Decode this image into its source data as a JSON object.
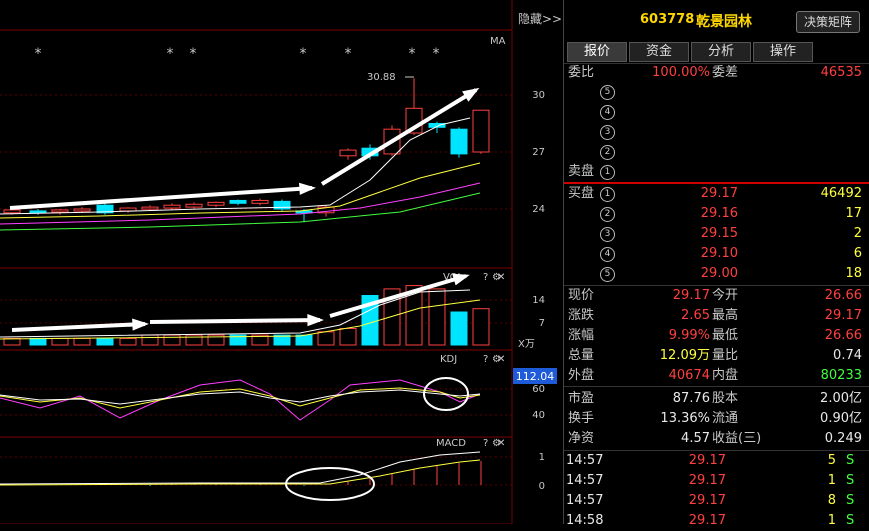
{
  "toolbar": {
    "hide_label": "隐藏>>"
  },
  "chart": {
    "main_indicator": "MA",
    "high_price_label": "30.88",
    "price_ticks": [
      "30",
      "27",
      "24"
    ],
    "vol_label": "VOL",
    "vol_ticks": [
      "14",
      "7"
    ],
    "vol_unit": "X万",
    "kdj_label": "KDJ",
    "kdj_value": "112.04",
    "kdj_ticks": [
      "60",
      "40"
    ],
    "macd_label": "MACD",
    "macd_ticks": [
      "1",
      "0"
    ],
    "star_marks": [
      "*",
      "*",
      "*",
      "*",
      "*",
      "*",
      "*"
    ]
  },
  "quote": {
    "code": "603778",
    "name": "乾景园林",
    "strategy_button": "决策矩阵",
    "tabs": [
      "报价",
      "资金",
      "分析",
      "操作"
    ],
    "weibi_label": "委比",
    "weibi_value": "100.00%",
    "weicha_label": "委差",
    "weicha_value": "46535",
    "sell_levels": [
      {
        "n": "5",
        "price": "",
        "vol": ""
      },
      {
        "n": "4",
        "price": "",
        "vol": ""
      },
      {
        "n": "3",
        "price": "",
        "vol": ""
      },
      {
        "n": "2",
        "price": "",
        "vol": ""
      },
      {
        "n": "1",
        "prefix": "卖盘",
        "price": "",
        "vol": ""
      }
    ],
    "buy_levels": [
      {
        "n": "1",
        "prefix": "买盘",
        "price": "29.17",
        "vol": "46492"
      },
      {
        "n": "2",
        "price": "29.16",
        "vol": "17"
      },
      {
        "n": "3",
        "price": "29.15",
        "vol": "2"
      },
      {
        "n": "4",
        "price": "29.10",
        "vol": "6"
      },
      {
        "n": "5",
        "price": "29.00",
        "vol": "18"
      }
    ],
    "stats": [
      {
        "l1": "现价",
        "v1": "29.17",
        "c1": "red",
        "l2": "今开",
        "v2": "26.66",
        "c2": "red"
      },
      {
        "l1": "涨跌",
        "v1": "2.65",
        "c1": "red",
        "l2": "最高",
        "v2": "29.17",
        "c2": "red"
      },
      {
        "l1": "涨幅",
        "v1": "9.99%",
        "c1": "red",
        "l2": "最低",
        "v2": "26.66",
        "c2": "red"
      },
      {
        "l1": "总量",
        "v1": "12.09万",
        "c1": "yellow",
        "l2": "量比",
        "v2": "0.74",
        "c2": "white"
      },
      {
        "l1": "外盘",
        "v1": "40674",
        "c1": "red",
        "l2": "内盘",
        "v2": "80233",
        "c2": "green"
      },
      {
        "l1": "市盈",
        "v1": "87.76",
        "c1": "white",
        "l2": "股本",
        "v2": "2.00亿",
        "c2": "white"
      },
      {
        "l1": "换手",
        "v1": "13.36%",
        "c1": "white",
        "l2": "流通",
        "v2": "0.90亿",
        "c2": "white"
      },
      {
        "l1": "净资",
        "v1": "4.57",
        "c1": "white",
        "l2": "收益(三)",
        "v2": "0.249",
        "c2": "white"
      }
    ],
    "ticks": [
      {
        "time": "14:57",
        "price": "29.17",
        "vol": "5",
        "side": "S"
      },
      {
        "time": "14:57",
        "price": "29.17",
        "vol": "1",
        "side": "S"
      },
      {
        "time": "14:57",
        "price": "29.17",
        "vol": "8",
        "side": "S"
      },
      {
        "time": "14:58",
        "price": "29.17",
        "vol": "1",
        "side": "S"
      }
    ]
  },
  "colors": {
    "up": "#ff4040",
    "down": "#00e5ff",
    "accent": "#ffd700",
    "ma5": "#ffffff",
    "ma10": "#ffff40",
    "ma20": "#ff40ff",
    "ma60": "#40ff40"
  }
}
